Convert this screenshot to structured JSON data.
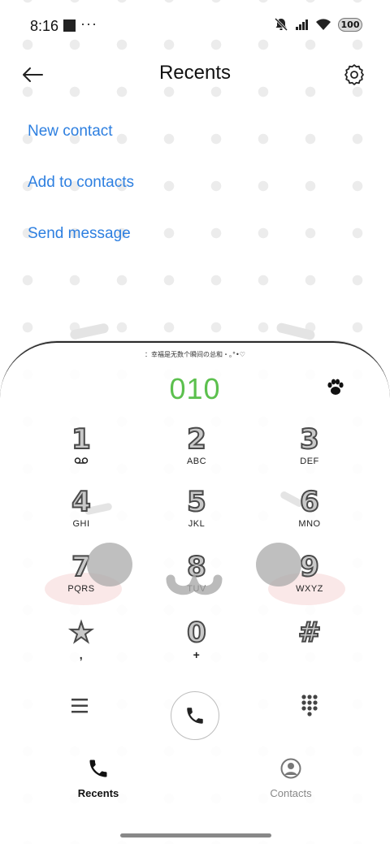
{
  "status_bar": {
    "time": "8:16",
    "overflow": "···",
    "battery": "100"
  },
  "header": {
    "title": "Recents"
  },
  "actions": {
    "new_contact": "New contact",
    "add_to_contacts": "Add to contacts",
    "send_message": "Send message"
  },
  "dialer": {
    "marquee": "：幸福是无数个瞬间の总和・｡°•♡",
    "number": "010",
    "number_color": "#5cc04e",
    "keys": [
      {
        "digit": "1",
        "letters": ""
      },
      {
        "digit": "2",
        "letters": "ABC"
      },
      {
        "digit": "3",
        "letters": "DEF"
      },
      {
        "digit": "4",
        "letters": "GHI"
      },
      {
        "digit": "5",
        "letters": "JKL"
      },
      {
        "digit": "6",
        "letters": "MNO"
      },
      {
        "digit": "7",
        "letters": "PQRS"
      },
      {
        "digit": "8",
        "letters": "TUV"
      },
      {
        "digit": "9",
        "letters": "WXYZ"
      },
      {
        "digit": "★",
        "letters": ","
      },
      {
        "digit": "0",
        "letters": "+"
      },
      {
        "digit": "#",
        "letters": ""
      }
    ]
  },
  "bottom_nav": {
    "recents": "Recents",
    "contacts": "Contacts"
  },
  "colors": {
    "link": "#2d7fe0",
    "accent_green": "#5cc04e"
  }
}
